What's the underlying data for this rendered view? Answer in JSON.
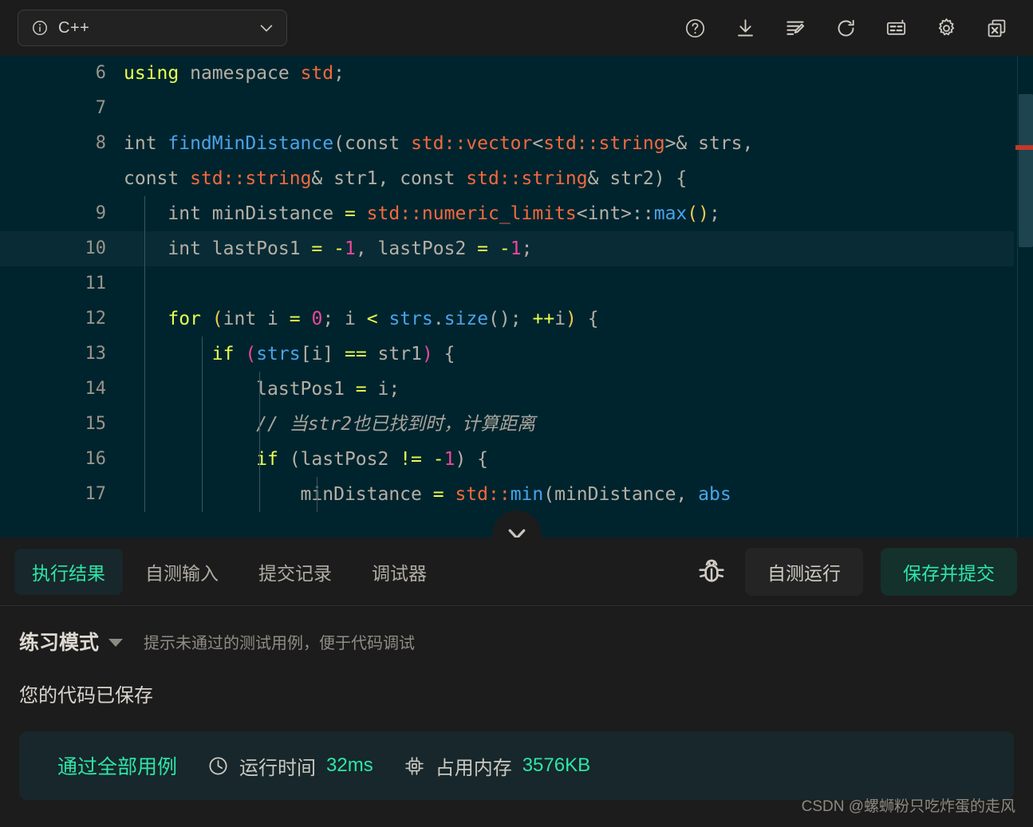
{
  "topbar": {
    "language": {
      "label": "C++",
      "info_icon": "info-circle-icon",
      "chevron_icon": "chevron-down-icon"
    },
    "icons": [
      {
        "name": "help-icon",
        "title": "帮助"
      },
      {
        "name": "download-icon",
        "title": "下载"
      },
      {
        "name": "format-code-icon",
        "title": "格式化"
      },
      {
        "name": "reset-icon",
        "title": "重置"
      },
      {
        "name": "keyboard-icon",
        "title": "快捷键"
      },
      {
        "name": "settings-gear-icon",
        "title": "设置"
      },
      {
        "name": "close-window-icon",
        "title": "关闭"
      }
    ]
  },
  "editor": {
    "lines": [
      {
        "num": "6",
        "indent_guides": 0,
        "highlight": false,
        "tokens": [
          {
            "t": "using",
            "c": "kw"
          },
          {
            "t": " namespace ",
            "c": "pl"
          },
          {
            "t": "std",
            "c": "type"
          },
          {
            "t": ";",
            "c": "pl"
          }
        ]
      },
      {
        "num": "7",
        "indent_guides": 0,
        "highlight": false,
        "tokens": []
      },
      {
        "num": "8",
        "indent_guides": 0,
        "highlight": false,
        "wrapped": true,
        "tokens": [
          {
            "t": "int ",
            "c": "pl"
          },
          {
            "t": "findMinDistance",
            "c": "fn"
          },
          {
            "t": "(",
            "c": "pl"
          },
          {
            "t": "const ",
            "c": "pl"
          },
          {
            "t": "std::vector",
            "c": "type"
          },
          {
            "t": "<",
            "c": "pl"
          },
          {
            "t": "std::string",
            "c": "type"
          },
          {
            "t": ">& ",
            "c": "pl"
          },
          {
            "t": "strs,",
            "c": "pl"
          },
          {
            "t": "\n",
            "c": "pl"
          },
          {
            "t": "const ",
            "c": "pl"
          },
          {
            "t": "std::string",
            "c": "type"
          },
          {
            "t": "& str1, ",
            "c": "pl"
          },
          {
            "t": "const ",
            "c": "pl"
          },
          {
            "t": "std::string",
            "c": "type"
          },
          {
            "t": "& str2) {",
            "c": "pl"
          }
        ]
      },
      {
        "num": "9",
        "indent_guides": 1,
        "highlight": false,
        "tokens": [
          {
            "t": "    int minDistance ",
            "c": "pl"
          },
          {
            "t": "=",
            "c": "op"
          },
          {
            "t": " ",
            "c": "pl"
          },
          {
            "t": "std::numeric_limits",
            "c": "type"
          },
          {
            "t": "<int>::",
            "c": "pl"
          },
          {
            "t": "max",
            "c": "fn"
          },
          {
            "t": "()",
            "c": "par1"
          },
          {
            "t": ";",
            "c": "pl"
          }
        ]
      },
      {
        "num": "10",
        "indent_guides": 1,
        "highlight": true,
        "tokens": [
          {
            "t": "    int lastPos1 ",
            "c": "pl"
          },
          {
            "t": "=",
            "c": "op"
          },
          {
            "t": " ",
            "c": "pl"
          },
          {
            "t": "-",
            "c": "op"
          },
          {
            "t": "1",
            "c": "num"
          },
          {
            "t": ", lastPos2 ",
            "c": "pl"
          },
          {
            "t": "=",
            "c": "op"
          },
          {
            "t": " ",
            "c": "pl"
          },
          {
            "t": "-",
            "c": "op"
          },
          {
            "t": "1",
            "c": "num"
          },
          {
            "t": ";",
            "c": "pl"
          }
        ]
      },
      {
        "num": "11",
        "indent_guides": 1,
        "highlight": false,
        "tokens": []
      },
      {
        "num": "12",
        "indent_guides": 1,
        "highlight": false,
        "tokens": [
          {
            "t": "    ",
            "c": "pl"
          },
          {
            "t": "for",
            "c": "kw"
          },
          {
            "t": " ",
            "c": "pl"
          },
          {
            "t": "(",
            "c": "par1"
          },
          {
            "t": "int i ",
            "c": "pl"
          },
          {
            "t": "=",
            "c": "op"
          },
          {
            "t": " ",
            "c": "pl"
          },
          {
            "t": "0",
            "c": "num"
          },
          {
            "t": "; i ",
            "c": "pl"
          },
          {
            "t": "<",
            "c": "op"
          },
          {
            "t": " ",
            "c": "pl"
          },
          {
            "t": "strs",
            "c": "fn"
          },
          {
            "t": ".",
            "c": "pl"
          },
          {
            "t": "size",
            "c": "fn"
          },
          {
            "t": "()",
            "c": "pl"
          },
          {
            "t": "; ",
            "c": "pl"
          },
          {
            "t": "++",
            "c": "op"
          },
          {
            "t": "i",
            "c": "pl"
          },
          {
            "t": ")",
            "c": "par1"
          },
          {
            "t": " {",
            "c": "pl"
          }
        ]
      },
      {
        "num": "13",
        "indent_guides": 2,
        "highlight": false,
        "tokens": [
          {
            "t": "        ",
            "c": "pl"
          },
          {
            "t": "if",
            "c": "kw"
          },
          {
            "t": " ",
            "c": "pl"
          },
          {
            "t": "(",
            "c": "par2"
          },
          {
            "t": "strs",
            "c": "fn"
          },
          {
            "t": "[i] ",
            "c": "pl"
          },
          {
            "t": "==",
            "c": "op"
          },
          {
            "t": " str1",
            "c": "pl"
          },
          {
            "t": ")",
            "c": "par2"
          },
          {
            "t": " {",
            "c": "pl"
          }
        ]
      },
      {
        "num": "14",
        "indent_guides": 3,
        "highlight": false,
        "tokens": [
          {
            "t": "            lastPos1 ",
            "c": "pl"
          },
          {
            "t": "=",
            "c": "op"
          },
          {
            "t": " i;",
            "c": "pl"
          }
        ]
      },
      {
        "num": "15",
        "indent_guides": 3,
        "highlight": false,
        "tokens": [
          {
            "t": "            // 当str2也已找到时，计算距离",
            "c": "cmt"
          }
        ]
      },
      {
        "num": "16",
        "indent_guides": 3,
        "highlight": false,
        "tokens": [
          {
            "t": "            ",
            "c": "pl"
          },
          {
            "t": "if",
            "c": "kw"
          },
          {
            "t": " (lastPos2 ",
            "c": "pl"
          },
          {
            "t": "!=",
            "c": "op"
          },
          {
            "t": " ",
            "c": "pl"
          },
          {
            "t": "-",
            "c": "op"
          },
          {
            "t": "1",
            "c": "num"
          },
          {
            "t": ") {",
            "c": "pl"
          }
        ]
      },
      {
        "num": "17",
        "indent_guides": 4,
        "highlight": false,
        "tokens": [
          {
            "t": "                minDistance ",
            "c": "pl"
          },
          {
            "t": "=",
            "c": "op"
          },
          {
            "t": " ",
            "c": "pl"
          },
          {
            "t": "std::",
            "c": "type"
          },
          {
            "t": "min",
            "c": "fn"
          },
          {
            "t": "(minDistance, ",
            "c": "pl"
          },
          {
            "t": "abs",
            "c": "fn"
          }
        ]
      }
    ],
    "collapse_icon": "chevron-down-icon"
  },
  "actionbar": {
    "tabs": [
      {
        "label": "执行结果",
        "active": true
      },
      {
        "label": "自测输入",
        "active": false
      },
      {
        "label": "提交记录",
        "active": false
      },
      {
        "label": "调试器",
        "active": false
      }
    ],
    "debug_icon": "bug-icon",
    "run_button": "自测运行",
    "submit_button": "保存并提交"
  },
  "result": {
    "mode_label": "练习模式",
    "mode_caret_icon": "caret-down-icon",
    "mode_hint": "提示未通过的测试用例，便于代码调试",
    "saved_message": "您的代码已保存",
    "verdict": "通过全部用例",
    "metrics": [
      {
        "icon": "clock-icon",
        "label": "运行时间",
        "value": "32ms"
      },
      {
        "icon": "memory-chip-icon",
        "label": "占用内存",
        "value": "3576KB"
      }
    ]
  },
  "watermark": "CSDN @螺蛳粉只吃炸蛋的走风",
  "colors": {
    "accent_green": "#2ee6a8",
    "editor_bg": "#00242e",
    "chrome_bg": "#1c1c1c",
    "card_bg": "#17272b",
    "error_marker": "#c0392b"
  }
}
